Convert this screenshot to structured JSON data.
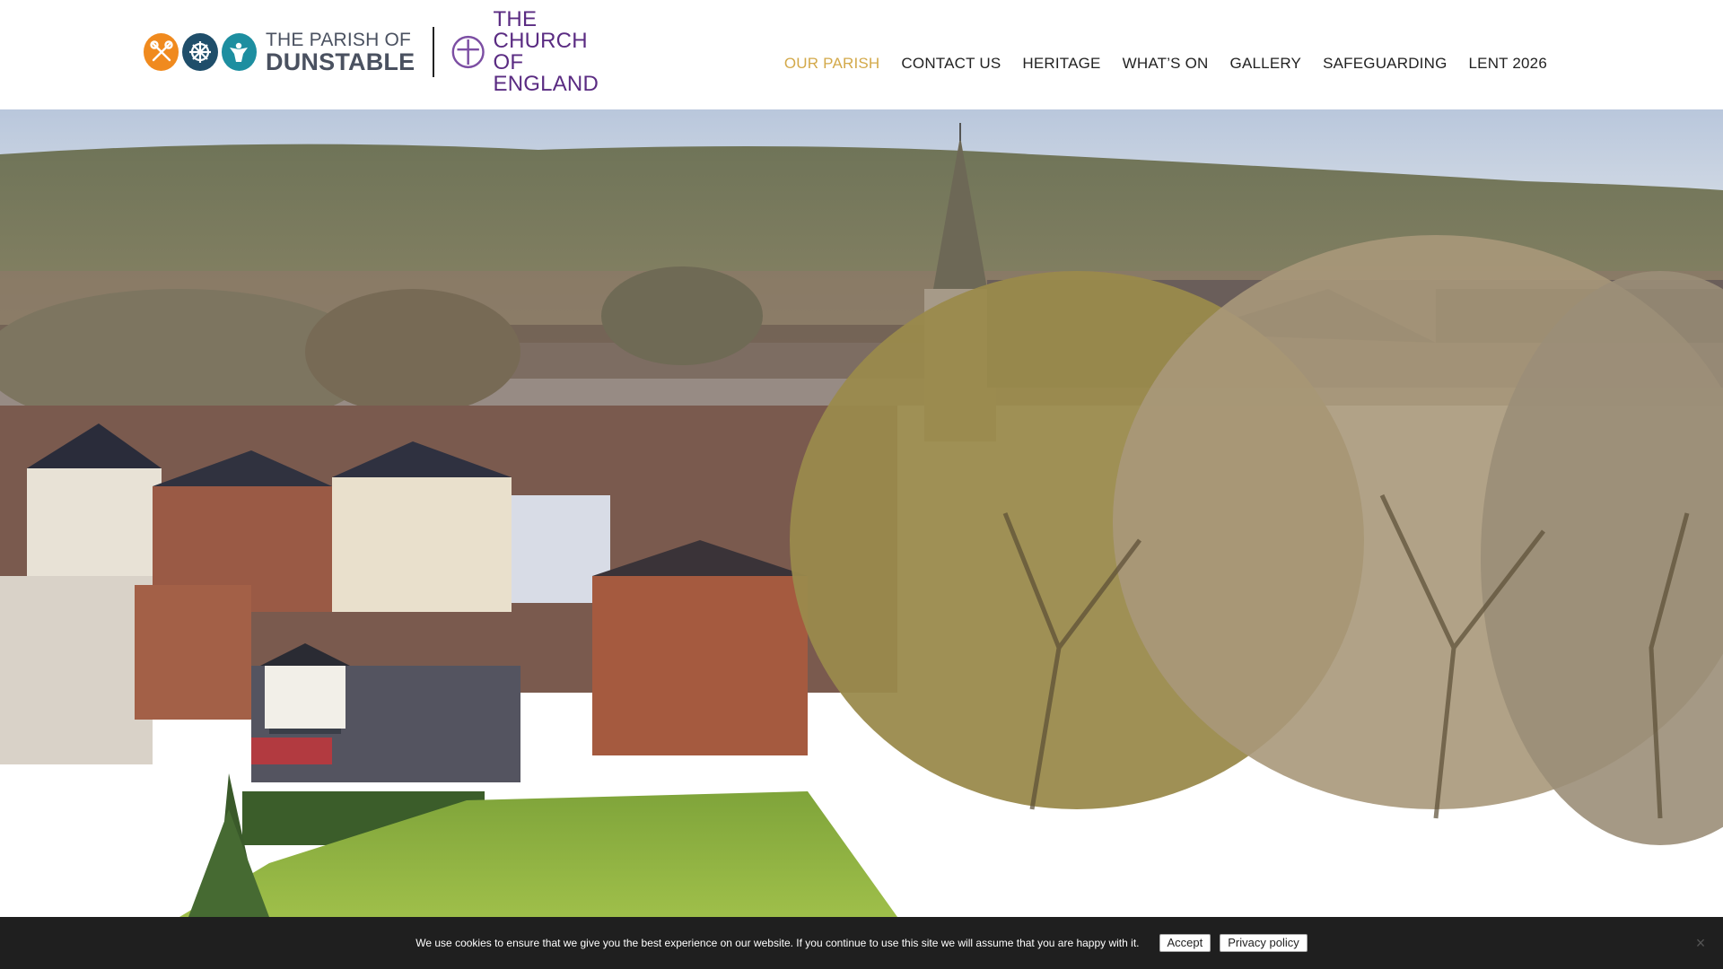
{
  "logo": {
    "parish_line1": "THE PARISH OF",
    "parish_line2": "DUNSTABLE",
    "coe_line1": "THE CHURCH",
    "coe_line2": "OF ENGLAND",
    "badge_colors": [
      "#f08a1e",
      "#1f4e6a",
      "#1d8ea0"
    ],
    "coe_color": "#5a2b82"
  },
  "nav": {
    "items": [
      {
        "label": "OUR PARISH",
        "active": true
      },
      {
        "label": "CONTACT US",
        "active": false
      },
      {
        "label": "HERITAGE",
        "active": false
      },
      {
        "label": "WHAT’S ON",
        "active": false
      },
      {
        "label": "GALLERY",
        "active": false
      },
      {
        "label": "SAFEGUARDING",
        "active": false
      },
      {
        "label": "LENT 2026",
        "active": false
      }
    ],
    "active_color": "#d3a94a"
  },
  "cookie": {
    "message": "We use cookies to ensure that we give you the best experience on our website. If you continue to use this site we will assume that you are happy with it.",
    "accept_label": "Accept",
    "privacy_label": "Privacy policy",
    "close_symbol": "×"
  }
}
